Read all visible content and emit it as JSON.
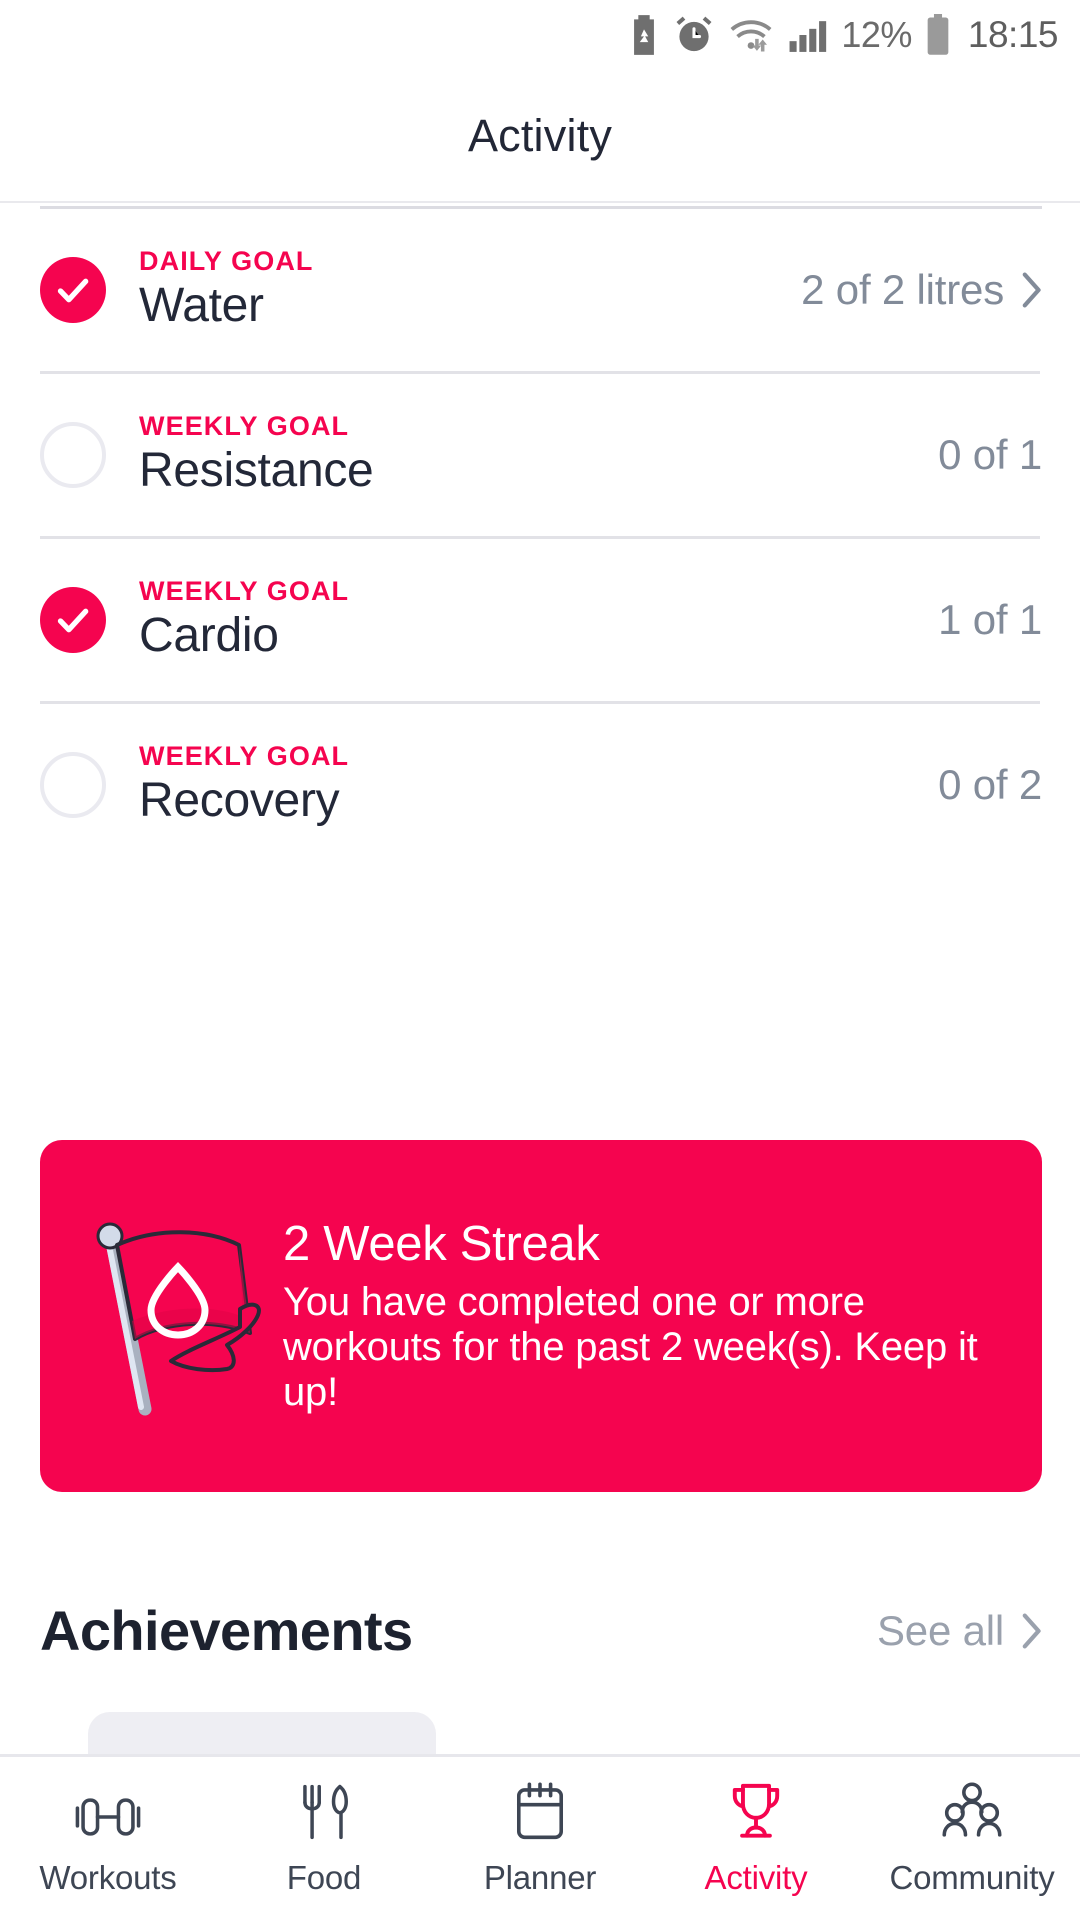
{
  "status_bar": {
    "icons": [
      "battery-saver-icon",
      "alarm-clock-icon",
      "wifi-icon",
      "cellular-signal-icon"
    ],
    "battery_percent": "12%",
    "battery_icon": "battery-icon",
    "time": "18:15"
  },
  "header": {
    "title": "Activity"
  },
  "goals": [
    {
      "kicker": "DAILY GOAL",
      "name": "Water",
      "value": "2 of 2 litres",
      "completed": true,
      "has_chevron": true
    },
    {
      "kicker": "WEEKLY GOAL",
      "name": "Resistance",
      "value": "0 of 1",
      "completed": false,
      "has_chevron": false
    },
    {
      "kicker": "WEEKLY GOAL",
      "name": "Cardio",
      "value": "1 of 1",
      "completed": true,
      "has_chevron": false
    },
    {
      "kicker": "WEEKLY GOAL",
      "name": "Recovery",
      "value": "0 of 2",
      "completed": false,
      "has_chevron": false
    }
  ],
  "streak_card": {
    "icon": "flag-with-water-drop-icon",
    "title": "2 Week Streak",
    "body": "You have completed one or more workouts for the past 2 week(s). Keep it up!"
  },
  "achievements": {
    "title": "Achievements",
    "see_all_label": "See all",
    "see_all_icon": "chevron-right-icon"
  },
  "bottom_nav": {
    "items": [
      {
        "label": "Workouts",
        "icon": "dumbbell-icon",
        "active": false
      },
      {
        "label": "Food",
        "icon": "cutlery-icon",
        "active": false
      },
      {
        "label": "Planner",
        "icon": "calendar-icon",
        "active": false
      },
      {
        "label": "Activity",
        "icon": "trophy-icon",
        "active": true
      },
      {
        "label": "Community",
        "icon": "people-icon",
        "active": false
      }
    ]
  },
  "colors": {
    "accent_pink": "#F5044F",
    "text_dark": "#232838",
    "text_muted": "#828b99",
    "divider": "#e2e2e7",
    "nav_icon": "#3e4654"
  }
}
